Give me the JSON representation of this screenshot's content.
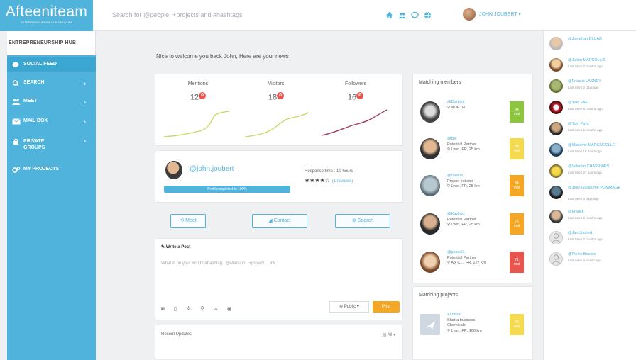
{
  "app": {
    "logo": "Afteeniteam",
    "logo_tagline": "ENTREPRENEURSHIP HUB NETWORK"
  },
  "search": {
    "placeholder": "Search for @people, +projects and #hashtags"
  },
  "header": {
    "icons": [
      "home-icon",
      "people-icon",
      "chat-icon",
      "globe-icon"
    ],
    "user_name": "JOHN JOUBERT ▾"
  },
  "sidebar": {
    "heading": "ENTREPRENEURSHIP HUB",
    "items": [
      {
        "label": "SOCIAL FEED",
        "icon": "comments-icon",
        "arrow": ""
      },
      {
        "label": "SEARCH",
        "icon": "search-icon",
        "arrow": "›"
      },
      {
        "label": "MEET",
        "icon": "people-icon",
        "arrow": "›"
      },
      {
        "label": "MAIL BOX",
        "icon": "mail-icon",
        "arrow": "›"
      },
      {
        "label": "PRIVATE GROUPS",
        "icon": "lock-icon",
        "arrow": "›"
      },
      {
        "label": "MY PROJECTS",
        "icon": "gears-icon",
        "arrow": ""
      }
    ]
  },
  "main": {
    "welcome": "Nice to welcome you back John, Here are your news",
    "stats": [
      {
        "label": "Mentions",
        "value": "12",
        "badge": "0",
        "color": "#c8d96a"
      },
      {
        "label": "Visitors",
        "value": "18",
        "badge": "0",
        "color": "#c8d96a"
      },
      {
        "label": "Followers",
        "value": "16",
        "badge": "0",
        "color": "#a33a5a"
      }
    ],
    "profile": {
      "handle": "@john.joubert",
      "progress_label": "Profil completed to 100%",
      "progress": 1.0,
      "response_time": "Response time : 10 hours",
      "stars": "★★★★☆",
      "reviews": "(1 reviews)"
    },
    "actions": [
      {
        "label": "⟲ Meet",
        "name": "meet-button"
      },
      {
        "label": "◢ Contact",
        "name": "contact-button"
      },
      {
        "label": "⊕ Search",
        "name": "search-button"
      }
    ],
    "write_post": {
      "title": "✎ Write a Post",
      "placeholder": "What is on your mind? #hashtag.. @Mention.. +project.. Link..",
      "tool_icons": [
        "camera-icon",
        "document-icon",
        "gear-icon",
        "pin-icon",
        "link-icon",
        "eye-icon"
      ],
      "visibility": "⊕ Public ▾",
      "post_label": "Post"
    },
    "recent_updates": {
      "title": "Recent Updates",
      "filter": "▤ All ▾"
    }
  },
  "matching_members": {
    "title": "Matching members",
    "items": [
      {
        "handle": "@Dorbies",
        "lines": [
          "⚲ NORTH"
        ],
        "score": "94\nmat",
        "color": "#8cc63f"
      },
      {
        "handle": "@Bel",
        "lines": [
          "Potential Partner",
          "⚲ Lyon, FR, 25 km"
        ],
        "score": "84\nmat",
        "color": "#f5d94e"
      },
      {
        "handle": "@Valen6",
        "lines": [
          "Project Initiator",
          "⚲ Lyon, FR, 25 km"
        ],
        "score": "84\nmat",
        "color": "#f5a623"
      },
      {
        "handle": "@Kaylhyz",
        "lines": [
          "Potential Partner",
          "⚲ Lyon, FR, 25 km"
        ],
        "score": "76\nmat",
        "color": "#f5a623"
      },
      {
        "handle": "@pascal1",
        "lines": [
          "Potential Partner",
          "⚲ Aix C..., FR, 127 km"
        ],
        "score": "71\nmat",
        "color": "#e8554e"
      }
    ]
  },
  "matching_projects": {
    "title": "Matching projects",
    "items": [
      {
        "handle": "+Xbison",
        "lines": [
          "Start a business",
          "Chemicals",
          "⚲ Lyon, FR, 160 km"
        ],
        "score": "72\nmat",
        "color": "#f5d94e"
      }
    ]
  },
  "online_users": [
    {
      "name": "@Jonathan BLUAR",
      "last_seen": ""
    },
    {
      "name": "@Julien MARSOLAIS",
      "last_seen": "Last Seen 2 months ago"
    },
    {
      "name": "@Francis LASNEY",
      "last_seen": "Last Seen 2 days ago"
    },
    {
      "name": "@Yael FAE",
      "last_seen": "Last Seen 6 months ago"
    },
    {
      "name": "@Tom Pays",
      "last_seen": "Last Seen 5 months ago"
    },
    {
      "name": "@Madame MARGUEOLLE",
      "last_seen": "Last Seen 18 hours ago"
    },
    {
      "name": "@Valentin CHAPPRAIS",
      "last_seen": "Last Seen 27 hours ago"
    },
    {
      "name": "@Jean Guillaume POMMAGE",
      "last_seen": "Last Seen 3 days ago"
    },
    {
      "name": "@Franck",
      "last_seen": "Last Seen 2 months ago"
    },
    {
      "name": "@Jan Joubert",
      "last_seen": "Last Seen 2 months ago"
    },
    {
      "name": "@Pierre Boutee",
      "last_seen": "Last Seen a month ago"
    }
  ],
  "colors": {
    "accent": "#4fb3dc",
    "sidebar_active": "#3ba6d1",
    "badge": "#e8554e",
    "post_button": "#f5a623"
  }
}
